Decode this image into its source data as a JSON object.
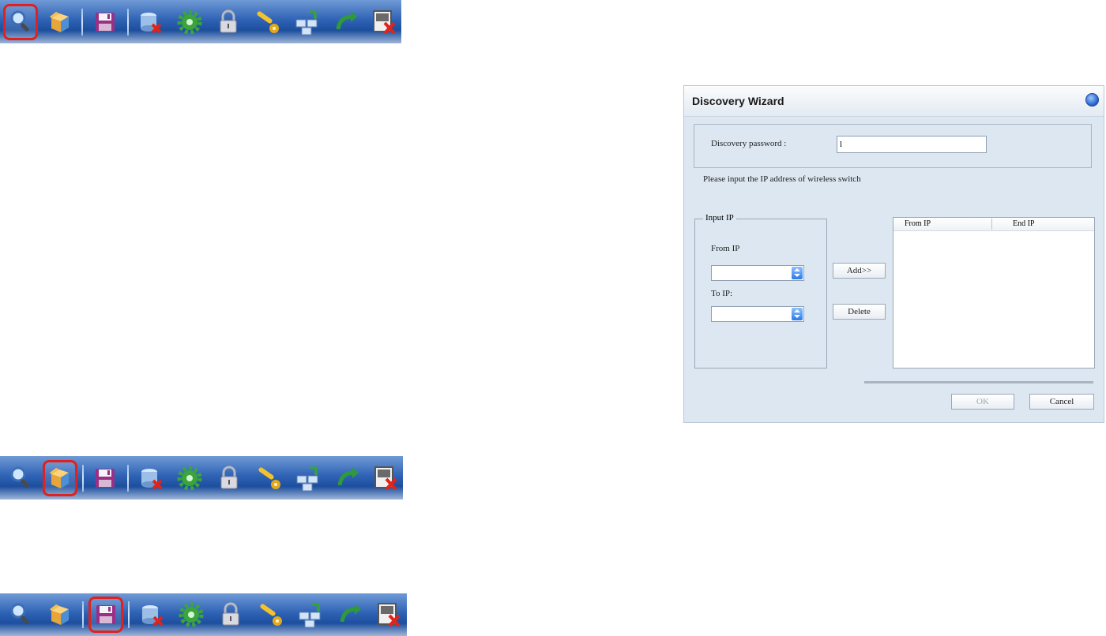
{
  "toolbar": {
    "buttons": [
      "search-icon",
      "box-icon",
      "save-icon",
      "database-delete-icon",
      "gear-icon",
      "lock-icon",
      "wrench-icon",
      "network-icon",
      "undo-arrow-icon",
      "exit-icon"
    ],
    "highlight_color": "#e0211d",
    "highlighted": {
      "toolbar_1": "search-icon",
      "toolbar_2": "box-icon",
      "toolbar_3": "save-icon"
    }
  },
  "dialog": {
    "title": "Discovery Wizard",
    "password_label": "Discovery password :",
    "password_value": "l",
    "instruction": "Please input the IP address of wireless switch",
    "group_label": "Input IP",
    "from_ip_label": "From IP",
    "to_ip_label": "To IP:",
    "add_button": "Add>>",
    "delete_button": "Delete",
    "list_headers": [
      "From IP",
      "End IP"
    ],
    "ok_button": "OK",
    "cancel_button": "Cancel"
  }
}
